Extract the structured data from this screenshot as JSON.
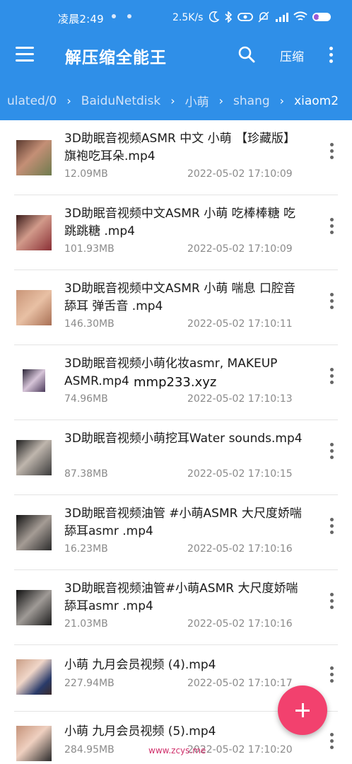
{
  "status_bar": {
    "time": "凌晨2:49",
    "net_speed": "2.5K/s",
    "battery": "32",
    "icons": [
      "moon-icon",
      "bluetooth-icon",
      "link-icon",
      "mute-icon",
      "hd-signal-icon",
      "wifi-icon",
      "battery-icon"
    ]
  },
  "app_bar": {
    "title": "解压缩全能王",
    "compress_label": "压缩",
    "icons": [
      "menu-icon",
      "search-icon",
      "more-vert-icon"
    ]
  },
  "breadcrumb": [
    "ulated/0",
    "BaiduNetdisk",
    "小萌",
    "shang",
    "xiaom2"
  ],
  "files": [
    {
      "name": "3D助眠音视频ASMR 中文 小萌 【珍藏版】旗袍吃耳朵.mp4",
      "size": "12.09MB",
      "date": "2022-05-02 17:10:09"
    },
    {
      "name": "3D助眠音视频中文ASMR 小萌 吃棒棒糖 吃跳跳糖 .mp4",
      "size": "101.93MB",
      "date": "2022-05-02 17:10:09"
    },
    {
      "name": "3D助眠音视频中文ASMR 小萌 喘息 口腔音 舔耳 弹舌音 .mp4",
      "size": "146.30MB",
      "date": "2022-05-02 17:10:11"
    },
    {
      "name": "3D助眠音视频小萌化妆asmr, MAKEUP ASMR.mp4",
      "size": "74.96MB",
      "date": "2022-05-02 17:10:13"
    },
    {
      "name": "3D助眠音视频小萌挖耳Water sounds.mp4",
      "size": "87.38MB",
      "date": "2022-05-02 17:10:15"
    },
    {
      "name": "3D助眠音视频油管 #小萌ASMR 大尺度娇喘舔耳asmr .mp4",
      "size": "16.23MB",
      "date": "2022-05-02 17:10:16"
    },
    {
      "name": "3D助眠音视频油管#小萌ASMR 大尺度娇喘舔耳asmr .mp4",
      "size": "21.03MB",
      "date": "2022-05-02 17:10:16"
    },
    {
      "name": "小萌 九月会员视频 (4).mp4",
      "size": "227.94MB",
      "date": "2022-05-02 17:10:17"
    },
    {
      "name": "小萌 九月会员视频 (5).mp4",
      "size": "284.95MB",
      "date": "2022-05-02 17:10:20"
    }
  ],
  "overlay_text": "mmp233.xyz",
  "watermark": "www.zcys.me",
  "colors": {
    "primary": "#2f8fe8",
    "fab": "#f2416e",
    "battery": "#9b59d6"
  }
}
